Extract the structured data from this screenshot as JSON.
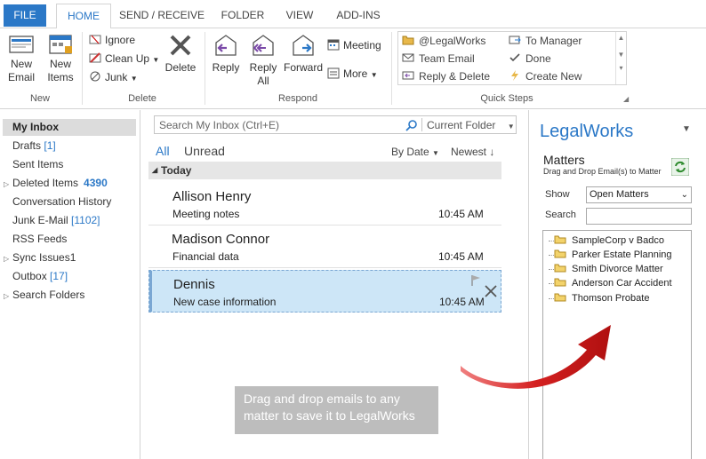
{
  "tabs": [
    "FILE",
    "HOME",
    "SEND / RECEIVE",
    "FOLDER",
    "VIEW",
    "ADD-INS"
  ],
  "active_tab": "HOME",
  "ribbon": {
    "new": {
      "group_label": "New",
      "new_email": "New\nEmail",
      "new_items": "New\nItems"
    },
    "delete": {
      "group_label": "Delete",
      "ignore": "Ignore",
      "clean_up": "Clean Up",
      "junk": "Junk",
      "delete": "Delete"
    },
    "respond": {
      "group_label": "Respond",
      "reply": "Reply",
      "reply_all": "Reply\nAll",
      "forward": "Forward",
      "meeting": "Meeting",
      "more": "More"
    },
    "quick_steps": {
      "group_label": "Quick Steps",
      "items": [
        "@LegalWorks",
        "To Manager",
        "Team Email",
        "Done",
        "Reply & Delete",
        "Create New"
      ]
    }
  },
  "folders": {
    "selected": "My Inbox",
    "items": [
      {
        "label": "Drafts",
        "count": "[1]"
      },
      {
        "label": "Sent Items"
      },
      {
        "label": "Deleted Items",
        "count": "4390",
        "expandable": true
      },
      {
        "label": "Conversation History"
      },
      {
        "label": "Junk E-Mail",
        "count": "[1102]"
      },
      {
        "label": "RSS Feeds"
      },
      {
        "label": "Sync Issues1",
        "expandable": true
      },
      {
        "label": "Outbox",
        "count": "[17]"
      },
      {
        "label": "Search Folders",
        "expandable": true
      }
    ]
  },
  "message_list": {
    "search_placeholder": "Search My Inbox (Ctrl+E)",
    "search_scope": "Current Folder",
    "filter_all": "All",
    "filter_unread": "Unread",
    "sort_by": "By Date",
    "sort_order": "Newest",
    "group_header": "Today",
    "messages": [
      {
        "from": "Allison Henry",
        "subject": "Meeting notes",
        "time": "10:45 AM"
      },
      {
        "from": "Madison Connor",
        "subject": "Financial data",
        "time": "10:45 AM"
      },
      {
        "from": "Dennis",
        "subject": "New case information",
        "time": "10:45 AM",
        "selected": true
      }
    ],
    "drag_note": "Drag and drop emails to any matter to save it to LegalWorks"
  },
  "legalworks": {
    "title": "LegalWorks",
    "matters_heading": "Matters",
    "matters_sub": "Drag and Drop Email(s) to Matter",
    "show_label": "Show",
    "show_value": "Open Matters",
    "search_label": "Search",
    "matters": [
      "SampleCorp v Badco",
      "Parker Estate Planning",
      "Smith Divorce Matter",
      "Anderson Car Accident",
      "Thomson Probate"
    ]
  },
  "colors": {
    "accent": "#2b78c7",
    "selected_row": "#cde6f7",
    "arrow": "#d42020"
  }
}
